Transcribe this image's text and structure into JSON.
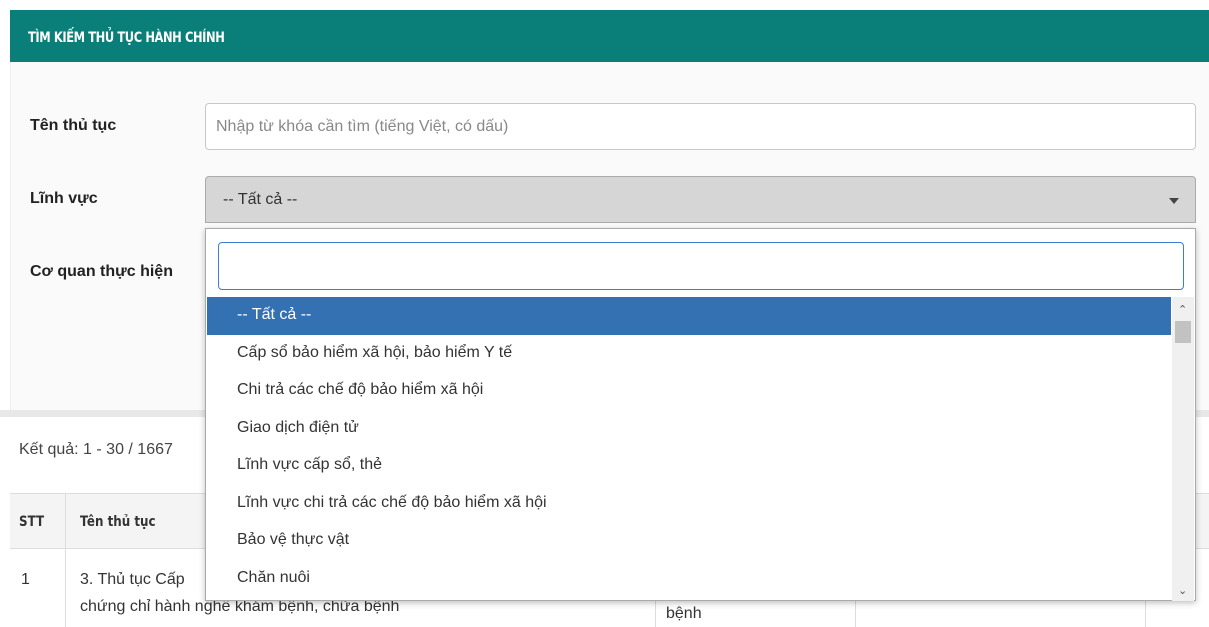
{
  "header": {
    "title": "TÌM KIẾM THỦ TỤC HÀNH CHÍNH"
  },
  "form": {
    "name_label": "Tên thủ tục",
    "name_placeholder": "Nhập từ khóa cần tìm (tiếng Việt, có dấu)",
    "field_label": "Lĩnh vực",
    "field_value": "-- Tất cả --",
    "agency_label": "Cơ quan thực hiện"
  },
  "dropdown": {
    "search_value": "",
    "options": [
      "-- Tất cả --",
      "Cấp sổ bảo hiểm xã hội, bảo hiểm Y tế",
      "Chi trả các chế độ bảo hiểm xã hội",
      "Giao dịch điện tử",
      "Lĩnh vực cấp sổ, thẻ",
      "Lĩnh vực chi trả các chế độ bảo hiểm xã hội",
      "Bảo vệ thực vật",
      "Chăn nuôi"
    ],
    "selected_index": 0
  },
  "results": {
    "summary": "Kết quả: 1 - 30 / 1667"
  },
  "table": {
    "headers": {
      "stt": "STT",
      "name": "Tên thủ tục"
    },
    "rows": [
      {
        "stt": "1",
        "name_line1": "3. Thủ tục Cấp",
        "name_line2": "chứng chỉ hành nghề khám bệnh, chữa bệnh",
        "field": "bệnh"
      }
    ]
  },
  "colors": {
    "header_bg": "#0a7e78",
    "selected_option_bg": "#3371b3",
    "search_border": "#3b7fd4"
  },
  "icons": {
    "select_caret": "caret-down-icon",
    "scroll_up": "scroll-up-icon",
    "scroll_down": "scroll-down-icon"
  }
}
